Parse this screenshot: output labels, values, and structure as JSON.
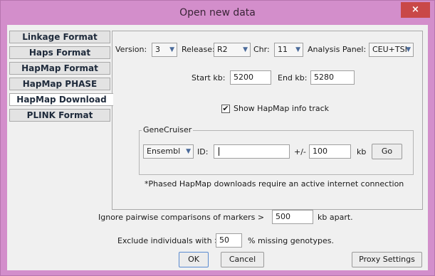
{
  "window": {
    "title": "Open new data",
    "close_glyph": "×"
  },
  "tabs": [
    {
      "label": "Linkage Format"
    },
    {
      "label": "Haps Format"
    },
    {
      "label": "HapMap Format"
    },
    {
      "label": "HapMap PHASE"
    },
    {
      "label": "HapMap Download"
    },
    {
      "label": "PLINK Format"
    }
  ],
  "download": {
    "version_label": "Version:",
    "version_value": "3",
    "release_label": "Release:",
    "release_value": "R2",
    "chr_label": "Chr:",
    "chr_value": "11",
    "panel_label": "Analysis Panel:",
    "panel_value": "CEU+TSI",
    "start_label": "Start kb:",
    "start_value": "5200",
    "end_label": "End kb:",
    "end_value": "5280",
    "info_track_label": "Show HapMap info track",
    "info_track_checked": "✔",
    "genecruiser": {
      "title": "GeneCruiser",
      "source_value": "Ensembl",
      "id_label": "ID:",
      "id_value": "",
      "plusminus_label": "+/-",
      "range_value": "100",
      "kb_label": "kb",
      "go_label": "Go"
    },
    "note": "*Phased HapMap downloads require an active internet connection"
  },
  "options": {
    "ignore_label": "Ignore pairwise comparisons of markers >",
    "ignore_value": "500",
    "ignore_suffix": "kb apart.",
    "exclude_label": "Exclude individuals with >",
    "exclude_value": "50",
    "exclude_suffix": "% missing genotypes."
  },
  "buttons": {
    "ok": "OK",
    "cancel": "Cancel",
    "proxy": "Proxy Settings"
  },
  "icons": {
    "dropdown": "chevron-down-icon",
    "close": "close-icon",
    "check": "checkmark-icon"
  }
}
